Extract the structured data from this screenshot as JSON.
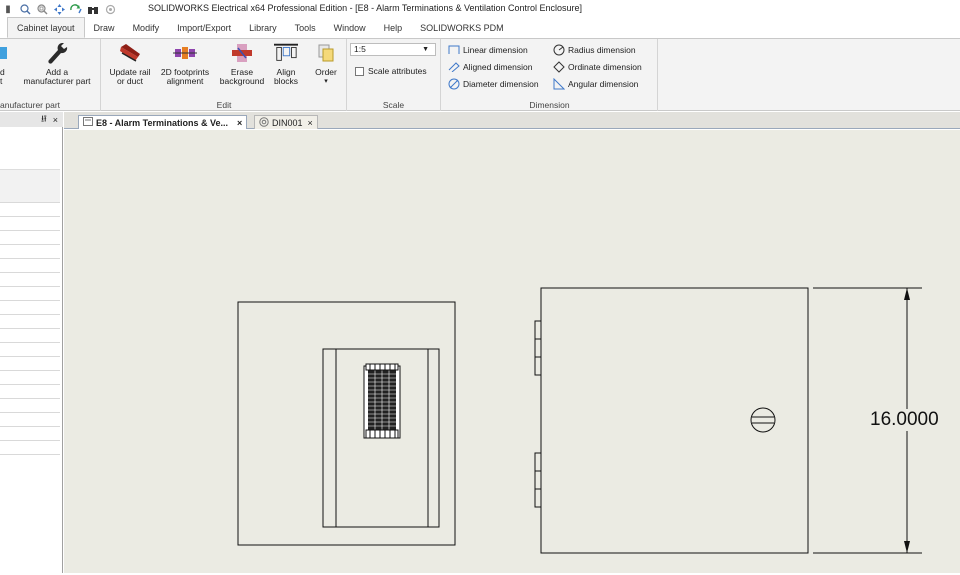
{
  "window": {
    "title": "SOLIDWORKS Electrical x64 Professional Edition - [E8 - Alarm Terminations & Ventilation Control Enclosure]"
  },
  "quick_access": [
    "zoom-fit-icon",
    "zoom-window-icon",
    "pan-icon",
    "sync-icon",
    "binoculars-icon",
    "settings-icon"
  ],
  "menu": {
    "tabs": [
      "Cabinet layout",
      "Draw",
      "Modify",
      "Import/Export",
      "Library",
      "Tools",
      "Window",
      "Help",
      "SOLIDWORKS PDM"
    ],
    "active": "Cabinet layout"
  },
  "ribbon": {
    "partial_group": {
      "btn1_line1": "d",
      "btn1_line2": "t",
      "add_line1": "Add a",
      "add_line2": "manufacturer part",
      "label": "anufacturer part"
    },
    "edit": {
      "label": "Edit",
      "update_line1": "Update rail",
      "update_line2": "or duct",
      "footprints_line1": "2D footprints",
      "footprints_line2": "alignment",
      "erase_line1": "Erase",
      "erase_line2": "background",
      "align_line1": "Align",
      "align_line2": "blocks",
      "order": "Order"
    },
    "scale": {
      "label": "Scale",
      "value": "1:5",
      "scale_attributes": "Scale attributes"
    },
    "dimension": {
      "label": "Dimension",
      "linear": "Linear dimension",
      "aligned": "Aligned dimension",
      "diameter": "Diameter dimension",
      "radius": "Radius dimension",
      "ordinate": "Ordinate dimension",
      "angular": "Angular dimension"
    }
  },
  "left_panel": {
    "pin": "⭿",
    "close": "×"
  },
  "doc_tabs": [
    {
      "label": "E8 - Alarm Terminations & Ve...",
      "close": "×",
      "active": true
    },
    {
      "label": "DIN001",
      "close": "×",
      "active": false
    }
  ],
  "drawing": {
    "dimension_value": "16.0000"
  },
  "colors": {
    "ribbon_bg": "#f3f3f3",
    "canvas_bg": "#ebebe3",
    "tab_border": "#9aa8bb"
  }
}
